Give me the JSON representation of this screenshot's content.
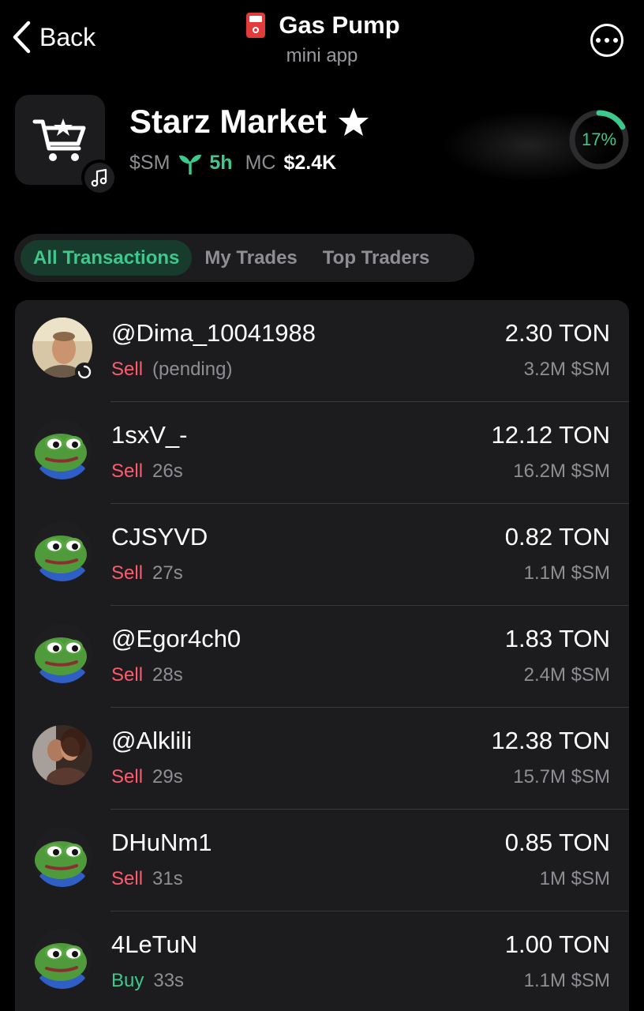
{
  "header": {
    "back_label": "Back",
    "title": "Gas Pump",
    "subtitle": "mini app",
    "title_icon": "fuel-pump-icon",
    "more_icon": "more-icon"
  },
  "token": {
    "name": "Starz Market",
    "ticker": "$SM",
    "age": "5h",
    "mc_label": "MC",
    "mc_value": "$2.4K",
    "progress_label": "17%",
    "progress": 0.17,
    "logo_icon": "shopping-cart-star-icon",
    "badge_icon": "music-note-icon",
    "favorite_icon": "star-icon",
    "age_icon": "sprout-icon"
  },
  "tabs": [
    {
      "label": "All Transactions",
      "active": true
    },
    {
      "label": "My Trades",
      "active": false
    },
    {
      "label": "Top Traders",
      "active": false
    }
  ],
  "transactions": [
    {
      "name": "@Dima_10041988",
      "side": "Sell",
      "time": "(pending)",
      "ton": "2.30 TON",
      "amount": "3.2M $SM",
      "avatar": "photo-man"
    },
    {
      "name": "1sxV_-",
      "side": "Sell",
      "time": "26s",
      "ton": "12.12 TON",
      "amount": "16.2M $SM",
      "avatar": "pepe"
    },
    {
      "name": "CJSYVD",
      "side": "Sell",
      "time": "27s",
      "ton": "0.82 TON",
      "amount": "1.1M $SM",
      "avatar": "pepe"
    },
    {
      "name": "@Egor4ch0",
      "side": "Sell",
      "time": "28s",
      "ton": "1.83 TON",
      "amount": "2.4M $SM",
      "avatar": "pepe"
    },
    {
      "name": "@Alklili",
      "side": "Sell",
      "time": "29s",
      "ton": "12.38 TON",
      "amount": "15.7M $SM",
      "avatar": "photo-couple"
    },
    {
      "name": "DHuNm1",
      "side": "Sell",
      "time": "31s",
      "ton": "0.85 TON",
      "amount": "1M $SM",
      "avatar": "pepe"
    },
    {
      "name": "4LeTuN",
      "side": "Buy",
      "time": "33s",
      "ton": "1.00 TON",
      "amount": "1.1M $SM",
      "avatar": "pepe"
    }
  ],
  "colors": {
    "accent_green": "#3cc98b",
    "sell_red": "#ff5a6e",
    "card_bg": "#1c1c1e",
    "muted": "#8e8e93"
  }
}
